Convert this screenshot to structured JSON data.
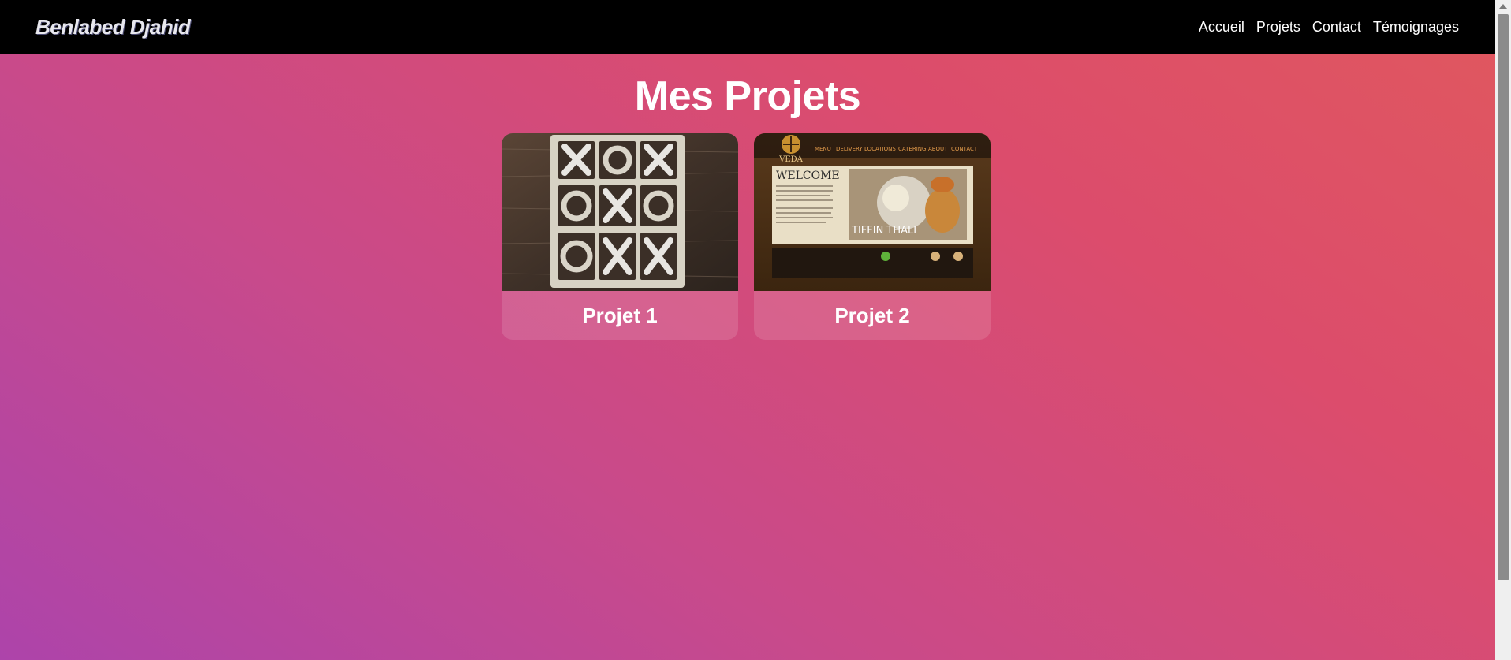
{
  "brand": "Benlabed Djahid",
  "nav": {
    "items": [
      "Accueil",
      "Projets",
      "Contact",
      "Témoignages"
    ]
  },
  "page": {
    "title": "Mes Projets"
  },
  "projects": [
    {
      "title": "Projet 1",
      "thumbnail": "tic-tac-toe board"
    },
    {
      "title": "Projet 2",
      "thumbnail": "restaurant website screenshot",
      "thumbnail_text": {
        "logo": "VEDA",
        "nav": [
          "MENU",
          "DELIVERY",
          "LOCATIONS",
          "CATERING",
          "ABOUT",
          "CONTACT"
        ],
        "heading": "WELCOME",
        "caption": "TIFFIN THALI"
      }
    }
  ],
  "colors": {
    "navbar": "#000000",
    "gradient_start": "#ad44aa",
    "gradient_end": "#e0585e"
  }
}
